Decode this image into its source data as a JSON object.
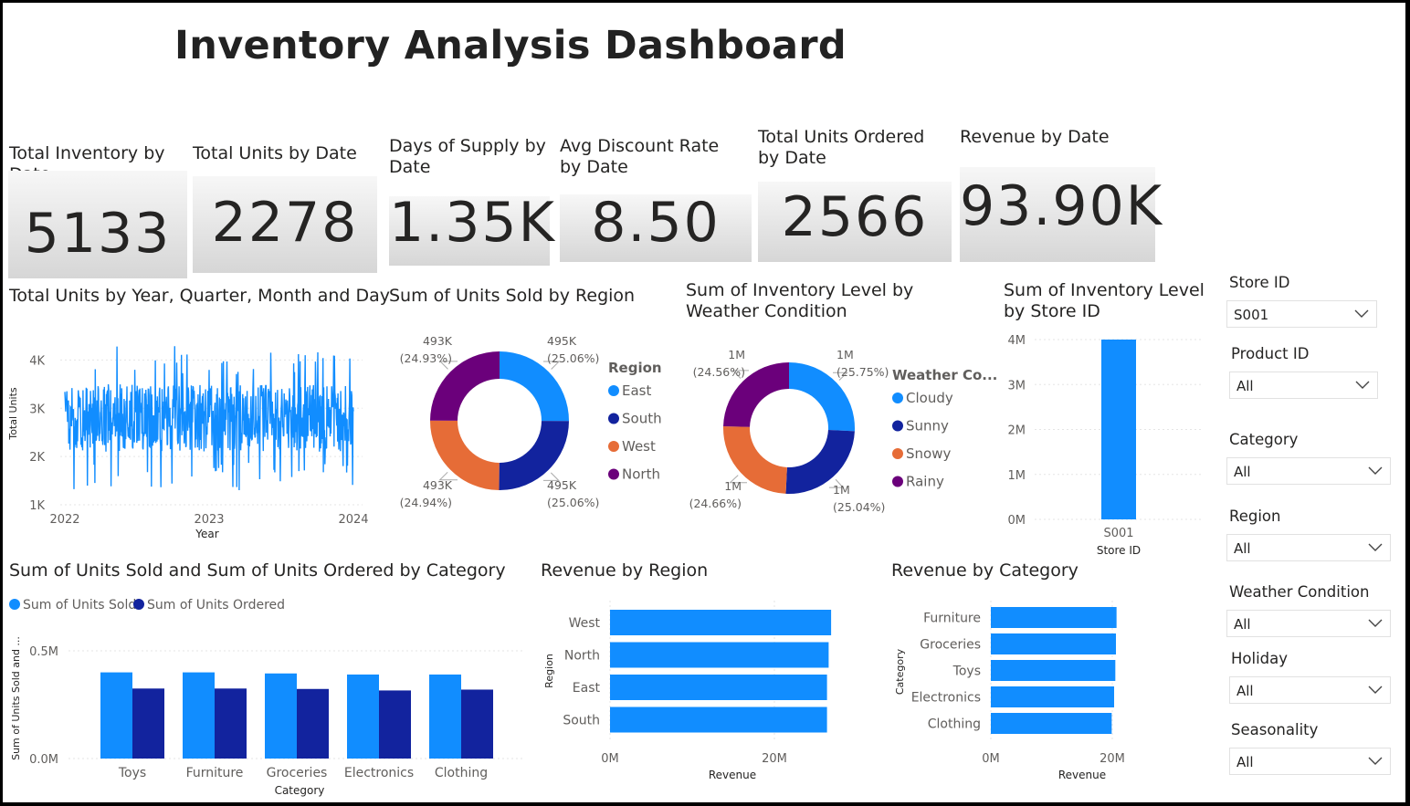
{
  "title": "Inventory Analysis Dashboard",
  "colors": {
    "blue": "#118DFF",
    "navy": "#12239E",
    "orange": "#E66C37",
    "purple": "#6B007B"
  },
  "kpis": [
    {
      "label": "Total Inventory by Date",
      "value": "5133"
    },
    {
      "label": "Total Units by Date",
      "value": "2278"
    },
    {
      "label": "Days of Supply by Date",
      "value": "1.35K"
    },
    {
      "label": "Avg Discount Rate by Date",
      "value": "8.50"
    },
    {
      "label": "Total Units Ordered by Date",
      "value": "2566"
    },
    {
      "label": "Revenue by Date",
      "value": "93.90K"
    }
  ],
  "slicers": [
    {
      "label": "Store ID",
      "value": "S001"
    },
    {
      "label": "Product ID",
      "value": "All"
    },
    {
      "label": "Category",
      "value": "All"
    },
    {
      "label": "Region",
      "value": "All"
    },
    {
      "label": "Weather Condition",
      "value": "All"
    },
    {
      "label": "Holiday",
      "value": "All"
    },
    {
      "label": "Seasonality",
      "value": "All"
    }
  ],
  "chart_data": [
    {
      "id": "units_line",
      "type": "line",
      "title": "Total Units by Year, Quarter, Month and Day",
      "xlabel": "Year",
      "ylabel": "Total Units",
      "xticks": [
        "2022",
        "2023",
        "2024"
      ],
      "yticks": [
        "1K",
        "2K",
        "3K",
        "4K"
      ],
      "ylim": [
        1000,
        4500
      ],
      "x_range": [
        "2022-01-01",
        "2024-01-01"
      ],
      "y_min": 1300,
      "y_max": 4300,
      "y_typical": [
        2100,
        3500
      ],
      "grid": true
    },
    {
      "id": "region_donut",
      "type": "pie",
      "title": "Sum of Units Sold by Region",
      "legend_title": "Region",
      "legend": [
        "East",
        "South",
        "West",
        "North"
      ],
      "values": [
        495,
        495,
        493,
        493
      ],
      "value_labels": [
        "495K",
        "495K",
        "493K",
        "493K"
      ],
      "percent_labels": [
        "(25.06%)",
        "(25.06%)",
        "(24.94%)",
        "(24.93%)"
      ],
      "colors": [
        "#118DFF",
        "#12239E",
        "#E66C37",
        "#6B007B"
      ]
    },
    {
      "id": "weather_donut",
      "type": "pie",
      "title": "Sum of Inventory Level by Weather Condition",
      "legend_title": "Weather Co...",
      "legend": [
        "Cloudy",
        "Sunny",
        "Snowy",
        "Rainy"
      ],
      "values": [
        25.75,
        25.04,
        24.66,
        24.56
      ],
      "value_labels": [
        "1M",
        "1M",
        "1M",
        "1M"
      ],
      "percent_labels": [
        "(25.75%)",
        "(25.04%)",
        "(24.66%)",
        "(24.56%)"
      ],
      "colors": [
        "#118DFF",
        "#12239E",
        "#E66C37",
        "#6B007B"
      ]
    },
    {
      "id": "store_bar",
      "type": "bar",
      "title": "Sum of Inventory Level by Store ID",
      "categories": [
        "S001"
      ],
      "values": [
        4000000
      ],
      "xlabel": "Store ID",
      "yticks": [
        "0M",
        "1M",
        "2M",
        "3M",
        "4M"
      ],
      "ylim": [
        0,
        4000000
      ]
    },
    {
      "id": "category_bar",
      "type": "bar",
      "title": "Sum of Units Sold and Sum of Units Ordered by Category",
      "categories": [
        "Toys",
        "Furniture",
        "Groceries",
        "Electronics",
        "Clothing"
      ],
      "series": [
        {
          "name": "Sum of Units Sold",
          "values": [
            400000,
            400000,
            395000,
            390000,
            390000
          ],
          "color": "#118DFF"
        },
        {
          "name": "Sum of Units Ordered",
          "values": [
            325000,
            325000,
            323000,
            316000,
            320000
          ],
          "color": "#12239E"
        }
      ],
      "xlabel": "Category",
      "ylabel": "Sum of Units Sold and ...",
      "yticks": [
        "0.0M",
        "0.5M"
      ],
      "ylim": [
        0,
        500000
      ]
    },
    {
      "id": "revenue_region",
      "type": "bar",
      "orientation": "horizontal",
      "title": "Revenue by Region",
      "categories": [
        "West",
        "North",
        "East",
        "South"
      ],
      "values": [
        26900000,
        26600000,
        26400000,
        26400000
      ],
      "xlabel": "Revenue",
      "ylabel": "Region",
      "xticks": [
        "0M",
        "20M"
      ],
      "xlim": [
        0,
        20000000
      ]
    },
    {
      "id": "revenue_category",
      "type": "bar",
      "orientation": "horizontal",
      "title": "Revenue by Category",
      "categories": [
        "Furniture",
        "Groceries",
        "Toys",
        "Electronics",
        "Clothing"
      ],
      "values": [
        20700000,
        20600000,
        20500000,
        20300000,
        19900000
      ],
      "xlabel": "Revenue",
      "ylabel": "Category",
      "xticks": [
        "0M",
        "20M"
      ],
      "xlim": [
        0,
        20000000
      ]
    }
  ]
}
